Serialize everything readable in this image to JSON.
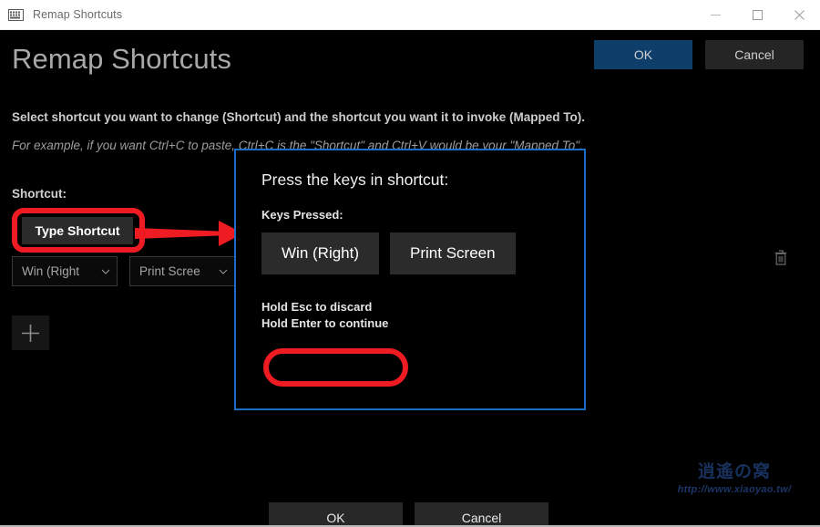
{
  "window": {
    "icon": "keyboard-icon",
    "title": "Remap Shortcuts",
    "controls": {
      "minimize": "minimize-icon",
      "maximize": "maximize-icon",
      "close": "close-icon"
    }
  },
  "header": {
    "title": "Remap Shortcuts",
    "ok_label": "OK",
    "cancel_label": "Cancel",
    "accent_color": "#0f3e6b"
  },
  "descriptions": {
    "line1": "Select shortcut you want to change (Shortcut) and the shortcut you want it to invoke (Mapped To).",
    "line2": "For example, if you want Ctrl+C to paste, Ctrl+C is the \"Shortcut\" and Ctrl+V would be your \"Mapped To\"."
  },
  "shortcut_section": {
    "label": "Shortcut:",
    "type_shortcut_label": "Type Shortcut",
    "combos": [
      {
        "value": "Win (Right",
        "icon": "chevron-down-icon"
      },
      {
        "value": "Print Scree",
        "icon": "chevron-down-icon"
      }
    ],
    "add_icon": "plus-icon",
    "delete_icon": "trash-icon"
  },
  "dialog": {
    "title": "Press the keys in shortcut:",
    "keys_label": "Keys Pressed:",
    "keys": [
      "Win (Right)",
      "Print Screen"
    ],
    "hints": [
      "Hold Esc to discard",
      "Hold Enter to continue"
    ],
    "ok_label": "OK",
    "cancel_label": "Cancel",
    "border_color": "#1a6fc4"
  },
  "annotations": {
    "highlight_color": "#ee1c22",
    "arrow": "red-arrow-right",
    "type_shortcut_box": "red-highlight-box",
    "ok_box": "red-highlight-box"
  },
  "watermark": {
    "mark": "逍遙の窝",
    "url": "http://www.xiaoyao.tw/"
  }
}
